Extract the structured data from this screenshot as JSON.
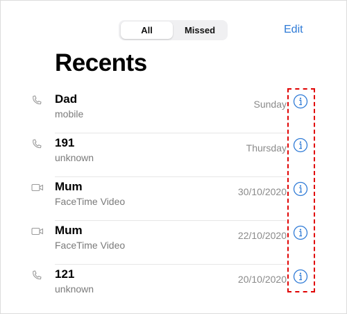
{
  "segments": {
    "all": "All",
    "missed": "Missed"
  },
  "edit_label": "Edit",
  "title": "Recents",
  "calls": [
    {
      "name": "Dad",
      "type": "mobile",
      "date": "Sunday",
      "icon": "phone-icon"
    },
    {
      "name": "191",
      "type": "unknown",
      "date": "Thursday",
      "icon": "phone-icon"
    },
    {
      "name": "Mum",
      "type": "FaceTime Video",
      "date": "30/10/2020",
      "icon": "video-camera-icon"
    },
    {
      "name": "Mum",
      "type": "FaceTime Video",
      "date": "22/10/2020",
      "icon": "video-camera-icon"
    },
    {
      "name": "121",
      "type": "unknown",
      "date": "20/10/2020",
      "icon": "phone-icon"
    }
  ],
  "colors": {
    "accent": "#2e7ad6",
    "highlight": "#e00000",
    "secondary_text": "#8a8a8a"
  }
}
